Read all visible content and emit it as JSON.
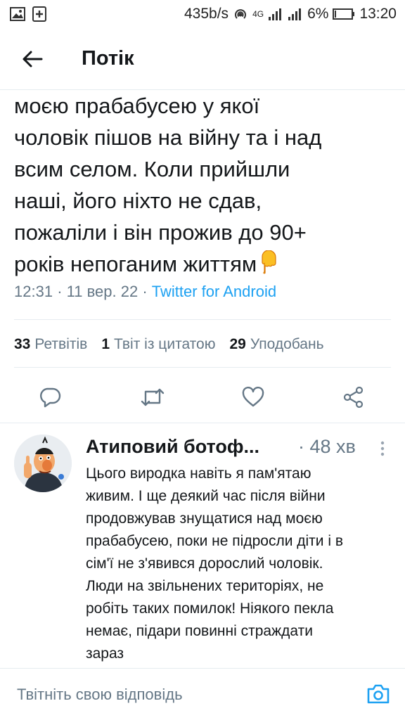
{
  "status_bar": {
    "speed": "435b/s",
    "network": "4G",
    "battery": "6%",
    "time": "13:20"
  },
  "header": {
    "title": "Потік",
    "back_icon": "arrow-left-icon"
  },
  "tweet": {
    "lines": [
      "моєю прабабусею у якої",
      "чоловік пішов на війну та і над",
      "всим селом. Коли прийшли",
      "наші, його ніхто не сдав,",
      "пожаліли і він прожив до 90+",
      "років непоганим життям"
    ],
    "emoji": "pointing-down-hand",
    "time": "12:31",
    "date": "11 вер. 22",
    "source": "Twitter for Android"
  },
  "stats": {
    "retweets_count": "33",
    "retweets_label": "Ретвітів",
    "quotes_count": "1",
    "quotes_label": "Твіт із цитатою",
    "likes_count": "29",
    "likes_label": "Уподобань"
  },
  "actions": [
    "reply-icon",
    "retweet-icon",
    "like-icon",
    "share-icon"
  ],
  "reply": {
    "name": "Атиповий ботоф...",
    "time": "· 48 хв",
    "lines": [
      "Цього виродка навіть я пам'ятаю",
      "живим. І ще деякий час після війни",
      "продовжував знущатися над моєю",
      "прабабусею, поки не підросли діти і в",
      "сім'ї не з'явився дорослий чоловік.",
      "Люди на звільнених територіях, не",
      "робіть таких помилок! Ніякого пекла",
      "немає, підари повинні страждати",
      "зараз"
    ]
  },
  "compose": {
    "placeholder": "Твітніть свою відповідь"
  },
  "colors": {
    "accent": "#1da1f2",
    "secondary_text": "#657786",
    "divider": "#e6ecf0"
  }
}
